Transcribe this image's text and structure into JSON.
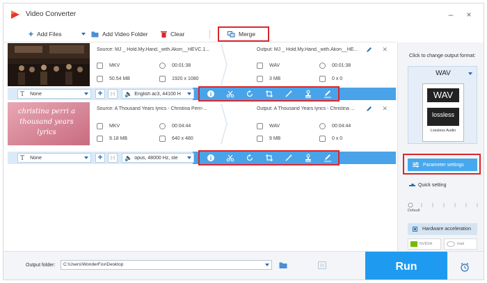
{
  "app": {
    "title": "Video Converter"
  },
  "toolbar": {
    "add_files": "Add Files",
    "add_video_folder": "Add Video Folder",
    "clear": "Clear",
    "merge": "Merge"
  },
  "files": [
    {
      "thumb_text": "",
      "source": "Source: MJ _ Hold.My.Hand._with.Akon__HEVC.1...",
      "output": "Output: MJ _ Hold.My.Hand._with.Akon__HE...",
      "src_format": "MKV",
      "src_duration": "00:01:38",
      "src_size": "50.54 MB",
      "src_resolution": "1920 x 1080",
      "out_format": "WAV",
      "out_duration": "00:01:38",
      "out_size": "3 MB",
      "out_resolution": "0 x 0",
      "subtitle": "None",
      "audio": "English ac3, 44100 H"
    },
    {
      "thumb_text": "christina perri a thousand years lyrics",
      "source": "Source: A Thousand Years lyrics - Christina Perri-...",
      "output": "Output: A Thousand Years lyrics - Christina ...",
      "src_format": "MKV",
      "src_duration": "00:04:44",
      "src_size": "9.18 MB",
      "src_resolution": "640 x 480",
      "out_format": "WAV",
      "out_duration": "00:04:44",
      "out_size": "9 MB",
      "out_resolution": "0 x 0",
      "subtitle": "None",
      "audio": "opus, 48000 Hz, ste"
    }
  ],
  "right_panel": {
    "change_label": "Click to change output format:",
    "format": "WAV",
    "format_icon_text": "WAV",
    "lossless_text": "lossless",
    "lossless_caption": "Lossless Audio",
    "param_settings": "Parameter settings",
    "quick_setting": "Quick setting",
    "slider_label": "Default",
    "hw_accel": "Hardware acceleration",
    "nvidia": "NVIDIA",
    "intel": "Intel"
  },
  "bottom": {
    "output_folder_label": "Output folder:",
    "output_folder_path": "C:\\Users\\WonderFox\\Desktop",
    "run": "Run"
  },
  "colors": {
    "accent": "#1e9bf0",
    "highlight": "#d9262c",
    "bar": "#4aa3e8"
  }
}
